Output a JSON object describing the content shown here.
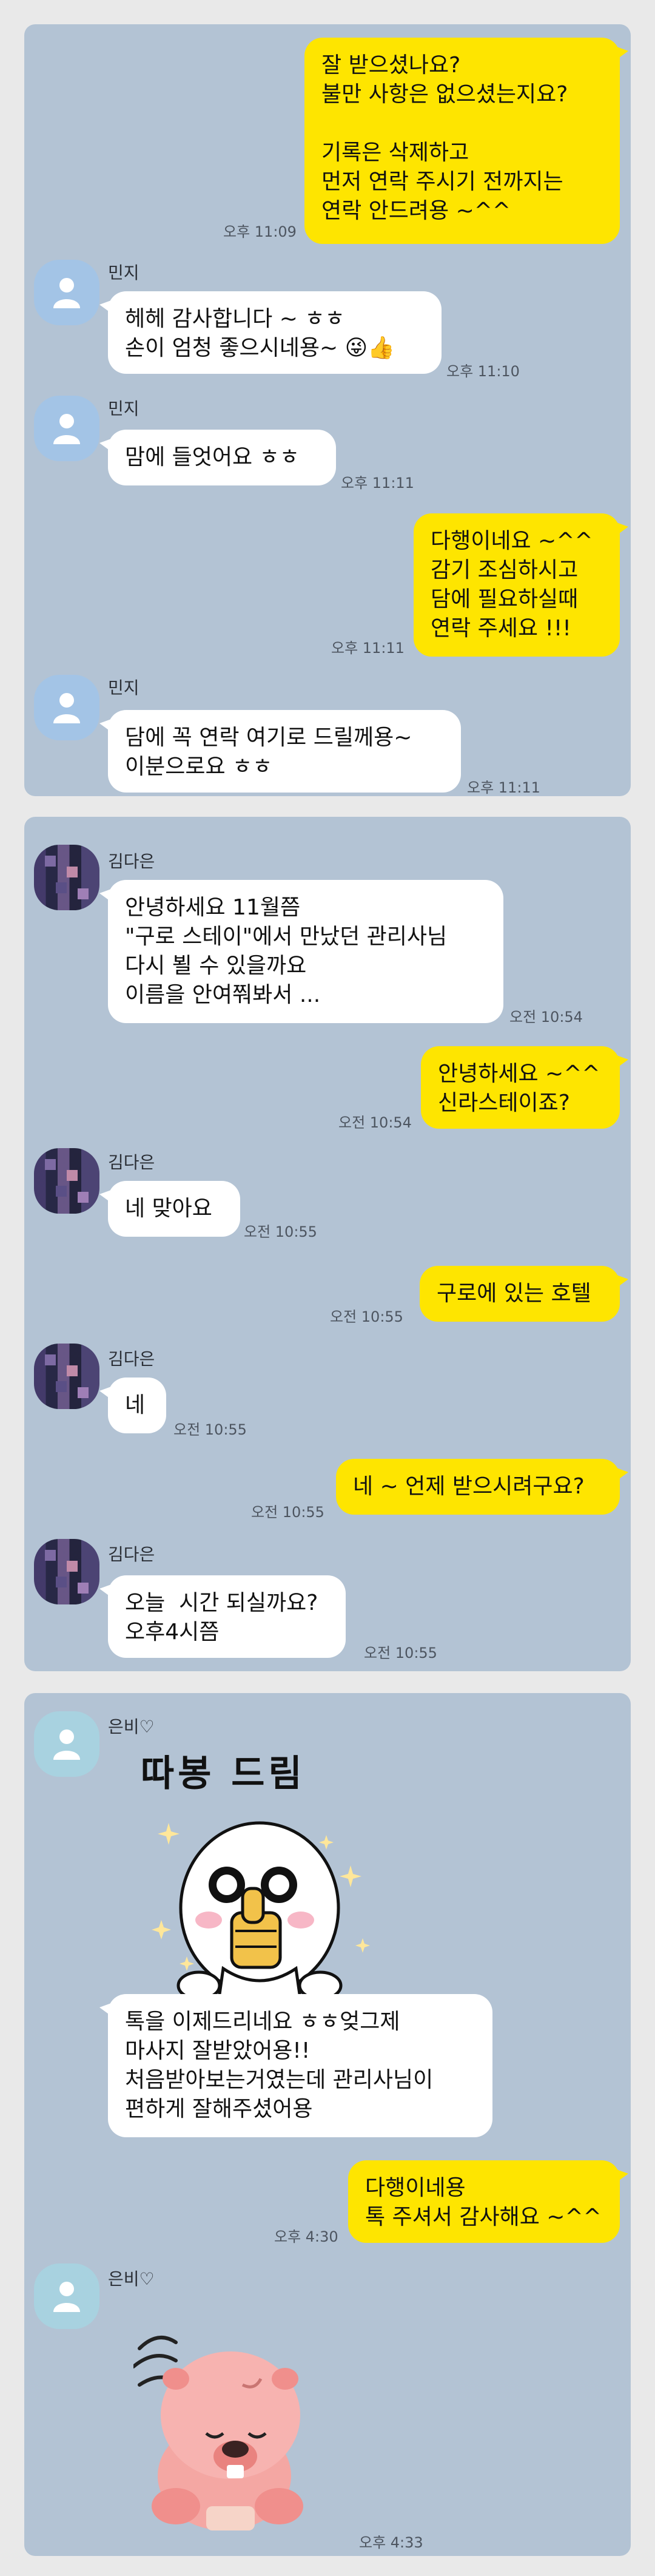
{
  "panel1": {
    "messages": [
      {
        "side": "mine",
        "text": "잘 받으셨나요?\n불만 사항은 없으셨는지요?\n\n기록은 삭제하고\n먼저 연락 주시기 전까지는\n연락 안드려용 ~^^",
        "time": "오후 11:09"
      },
      {
        "side": "theirs",
        "name": "민지",
        "text": "헤헤 감사합니다 ~ ㅎㅎ\n손이 엄청 좋으시네용~ 😜👍",
        "time": "오후 11:10"
      },
      {
        "side": "theirs",
        "name": "민지",
        "text": "맘에 들엇어요 ㅎㅎ",
        "time": "오후 11:11"
      },
      {
        "side": "mine",
        "text": "다행이네요 ~^^\n감기 조심하시고\n담에 필요하실때\n연락 주세요 !!!",
        "time": "오후 11:11"
      },
      {
        "side": "theirs",
        "name": "민지",
        "text": "담에 꼭 연락 여기로 드릴께용~\n이분으로요 ㅎㅎ",
        "time": "오후 11:11"
      }
    ]
  },
  "panel2": {
    "messages": [
      {
        "side": "theirs",
        "name": "김다은",
        "text": "안녕하세요 11월쯤\n\"구로 스테이\"에서 만났던 관리사님\n다시 뵐 수 있을까요\n이름을 안여쭤봐서 ...",
        "time": "오전 10:54"
      },
      {
        "side": "mine",
        "text": "안녕하세요 ~^^\n신라스테이죠?",
        "time": "오전 10:54"
      },
      {
        "side": "theirs",
        "name": "김다은",
        "text": "네 맞아요",
        "time": "오전 10:55"
      },
      {
        "side": "mine",
        "text": "구로에 있는 호텔",
        "time": "오전 10:55"
      },
      {
        "side": "theirs",
        "name": "김다은",
        "text": "네",
        "time": "오전 10:55"
      },
      {
        "side": "mine",
        "text": "네 ~ 언제 받으시려구요?",
        "time": "오전 10:55"
      },
      {
        "side": "theirs",
        "name": "김다은",
        "text": "오늘  시간 되실까요?\n오후4시쯤",
        "time": "오전 10:55"
      }
    ]
  },
  "panel3": {
    "sender": "은비♡",
    "sticker1_caption": "따봉 드림",
    "messages": [
      {
        "side": "theirs",
        "text": "톡을 이제드리네요 ㅎㅎ엊그제\n마사지 잘받았어용!!\n처음받아보는거였는데 관리사님이\n편하게 잘해주셨어용",
        "time": ""
      },
      {
        "side": "mine",
        "text": "다행이네용\n톡 주셔서 감사해요 ~^^",
        "time": "오후 4:30"
      },
      {
        "side": "theirs",
        "name": "은비♡",
        "text": "",
        "time": "오후 4:33"
      }
    ]
  },
  "colors": {
    "background": "#b3c3d4",
    "mine_bubble": "#fee500",
    "theirs_bubble": "#ffffff"
  }
}
